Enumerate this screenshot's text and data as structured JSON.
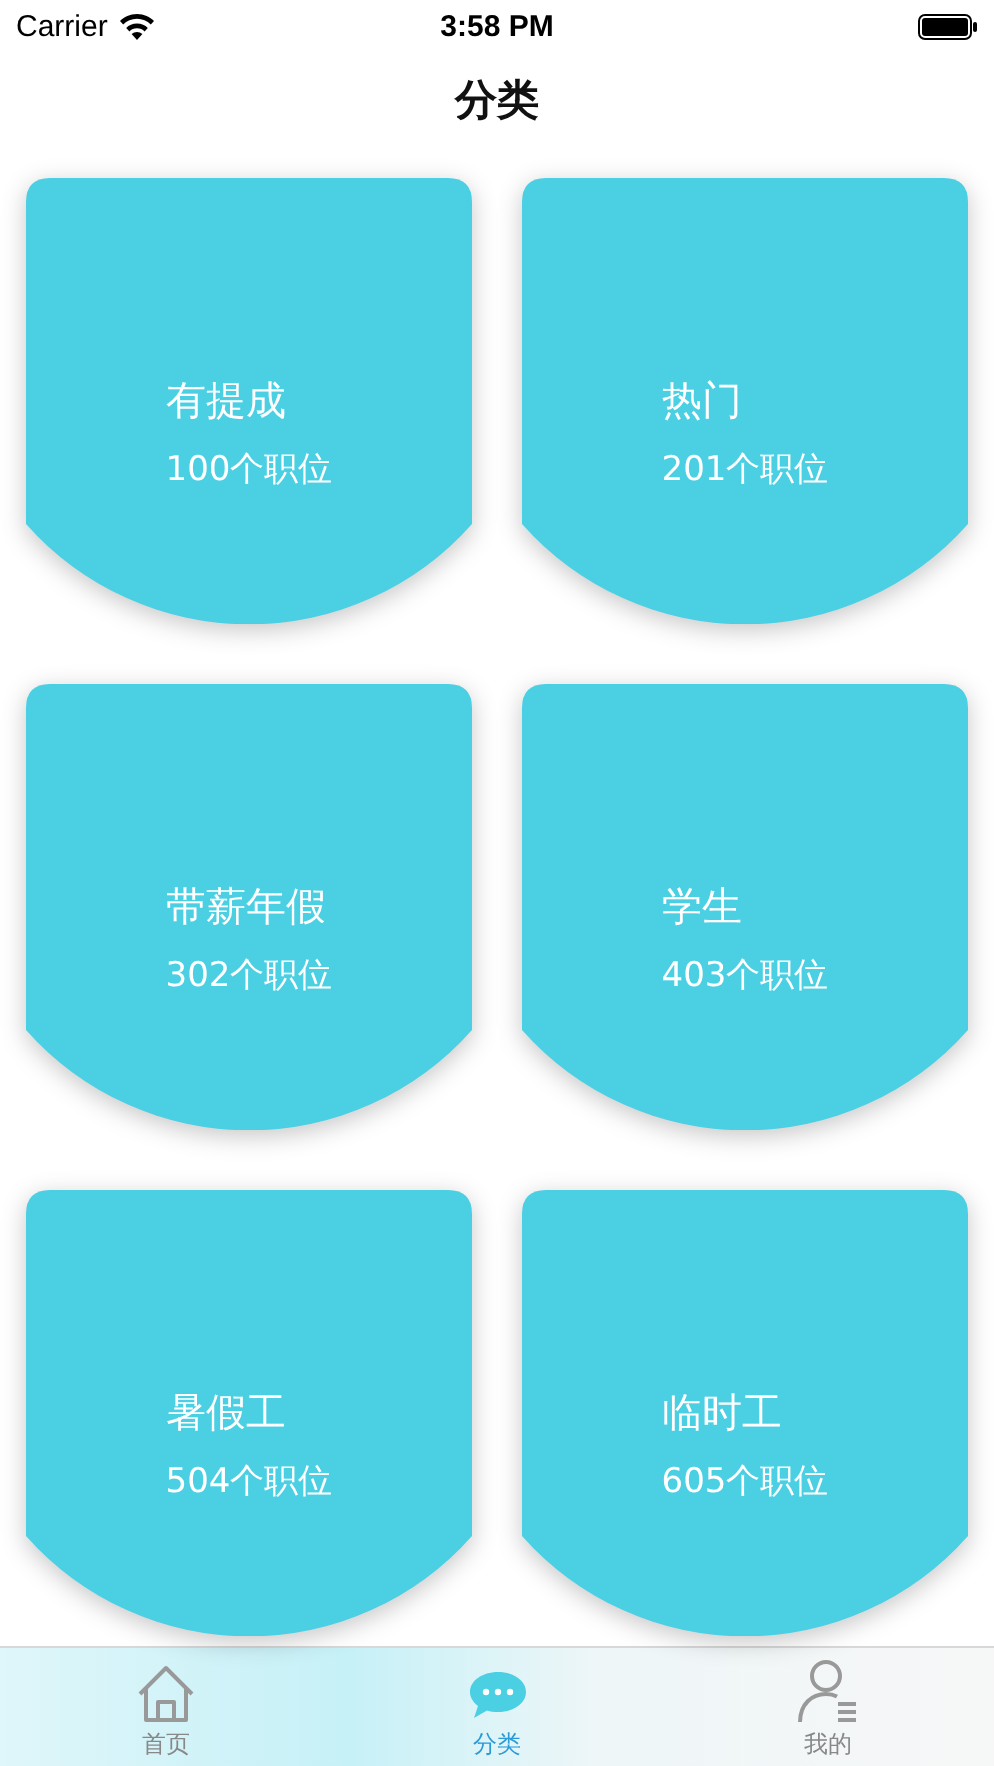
{
  "status_bar": {
    "carrier": "Carrier",
    "time": "3:58 PM"
  },
  "nav": {
    "title": "分类"
  },
  "categories": [
    {
      "title": "有提成",
      "count": "100个职位"
    },
    {
      "title": "热门",
      "count": "201个职位"
    },
    {
      "title": "带薪年假",
      "count": "302个职位"
    },
    {
      "title": "学生",
      "count": "403个职位"
    },
    {
      "title": "暑假工",
      "count": "504个职位"
    },
    {
      "title": "临时工",
      "count": "605个职位"
    }
  ],
  "tab_bar": [
    {
      "kind": "home",
      "label": "首页",
      "selected": false
    },
    {
      "kind": "chat",
      "label": "分类",
      "selected": true
    },
    {
      "kind": "profile",
      "label": "我的",
      "selected": false
    }
  ]
}
